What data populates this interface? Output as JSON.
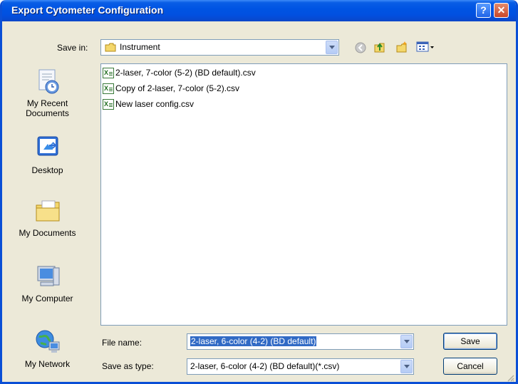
{
  "window": {
    "title": "Export Cytometer Configuration",
    "help_label": "?",
    "close_label": "✕"
  },
  "save_in": {
    "label": "Save in:",
    "value": "Instrument"
  },
  "toolbar": {
    "icons": [
      "back-icon",
      "up-folder-icon",
      "new-folder-icon",
      "view-menu-icon"
    ]
  },
  "sidebar": {
    "items": [
      {
        "label": "My Recent\nDocuments",
        "icon": "recent-documents-icon"
      },
      {
        "label": "Desktop",
        "icon": "desktop-icon"
      },
      {
        "label": "My Documents",
        "icon": "my-documents-icon"
      },
      {
        "label": "My Computer",
        "icon": "my-computer-icon"
      },
      {
        "label": "My Network",
        "icon": "my-network-icon"
      }
    ]
  },
  "files": [
    {
      "name": "2-laser, 7-color (5-2) (BD default).csv"
    },
    {
      "name": "Copy of 2-laser, 7-color (5-2).csv"
    },
    {
      "name": "New laser config.csv"
    }
  ],
  "file_name": {
    "label": "File name:",
    "value": "2-laser, 6-color (4-2) (BD default)"
  },
  "save_as_type": {
    "label": "Save as type:",
    "value": "2-laser, 6-color (4-2) (BD default)(*.csv)"
  },
  "buttons": {
    "save": "Save",
    "cancel": "Cancel"
  }
}
